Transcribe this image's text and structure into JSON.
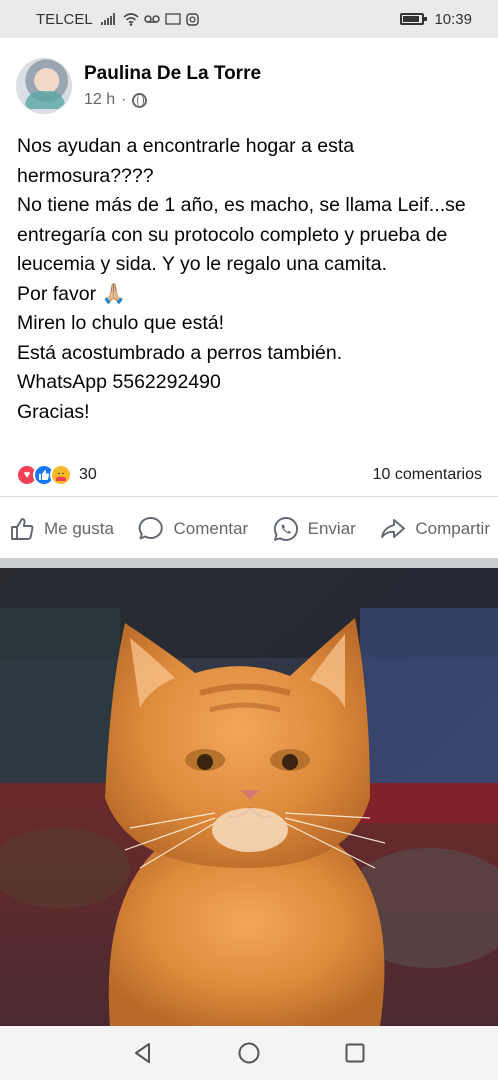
{
  "status_bar": {
    "carrier": "TELCEL",
    "time": "10:39"
  },
  "post": {
    "author": "Paulina De La Torre",
    "time_ago": "12 h",
    "dot": "·",
    "text_lines": [
      "Nos ayudan a encontrarle hogar a esta hermosura????",
      "No tiene más de 1 año, es macho, se llama Leif...se entregaría con su protocolo completo y prueba de leucemia y sida. Y yo le regalo una camita.",
      "Por favor 🙏🏼",
      "Miren lo chulo que está!",
      "Está acostumbrado a perros también.",
      "WhatsApp 5562292490",
      "Gracias!"
    ],
    "reaction_count": "30",
    "comments_count": "10 comentarios"
  },
  "actions": {
    "like": "Me gusta",
    "comment": "Comentar",
    "send": "Enviar",
    "share": "Compartir"
  },
  "icons": {
    "reactions": [
      "love-reaction-icon",
      "like-reaction-icon",
      "care-reaction-icon"
    ],
    "nav": [
      "back-icon",
      "home-icon",
      "recents-icon"
    ]
  },
  "colors": {
    "like_blue": "#1877f2",
    "love_red": "#f33e58",
    "care_yellow": "#f7b928",
    "secondary_text": "#65676b"
  }
}
